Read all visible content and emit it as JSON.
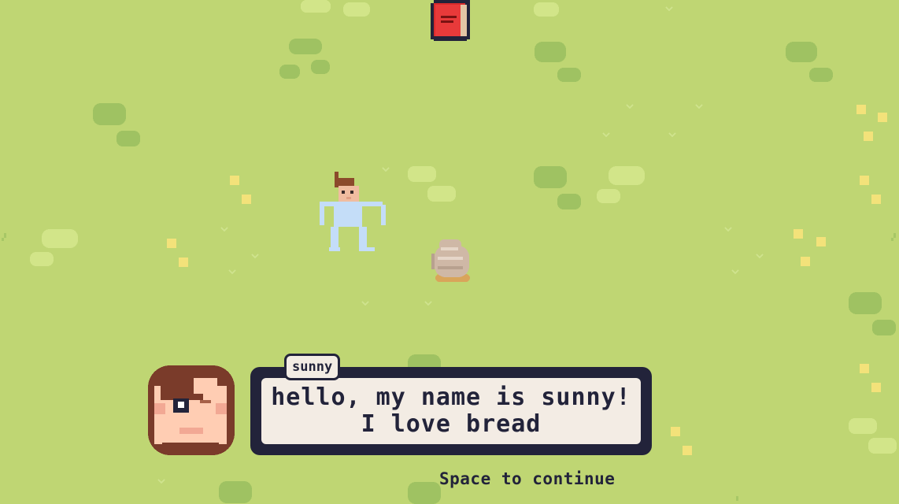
{
  "scene": {
    "background_color": "#bfd673",
    "dark_grass_color": "#9fc262",
    "light_grass_color": "#d2e589",
    "flower_color": "#f3e27a"
  },
  "sprites": {
    "journal_icon": "red-book-icon",
    "player": "player-character",
    "bread": "bread-loaf-item"
  },
  "dialog": {
    "speaker": "sunny",
    "text": "hello, my name is sunny! I love bread",
    "portrait": "sunny-portrait",
    "continue_hint": "Space to continue"
  }
}
